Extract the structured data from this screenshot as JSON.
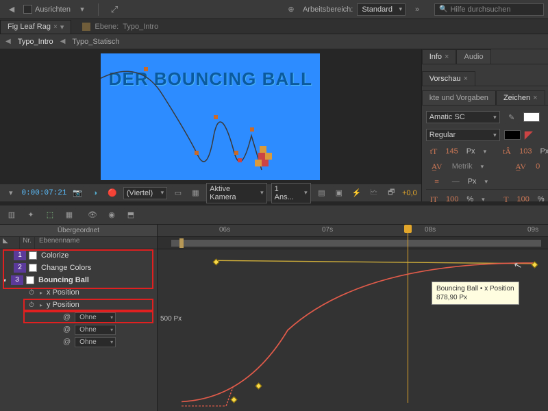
{
  "top": {
    "align": "Ausrichten",
    "workspace_label": "Arbeitsbereich:",
    "workspace_value": "Standard",
    "search_placeholder": "Hilfe durchsuchen"
  },
  "project": {
    "tab": "Fig Leaf Rag",
    "layer_label": "Ebene:",
    "layer_name": "Typo_Intro"
  },
  "crumb": {
    "a": "Typo_Intro",
    "b": "Typo_Statisch"
  },
  "canvas": {
    "title": "DER BOUNCING BALL"
  },
  "side": {
    "info_tab": "Info",
    "audio_tab": "Audio",
    "preview_tab": "Vorschau",
    "presets_tab": "kte und Vorgaben",
    "char_tab": "Zeichen",
    "font": "Amatic SC",
    "weight": "Regular",
    "size": "145",
    "size_unit": "Px",
    "leading": "103",
    "leading_unit": "Px",
    "kern": "Metrik",
    "track": "0",
    "vscale": "—",
    "vscale_unit": "Px",
    "scale1": "100",
    "scale2": "100",
    "scale_unit": "%"
  },
  "viewer": {
    "timecode": "0:00:07:21",
    "resolution": "(Viertel)",
    "camera": "Aktive Kamera",
    "views": "1 Ans...",
    "plus": "+0,0"
  },
  "timeline": {
    "parent": "Übergeordnet",
    "col_nr": "Nr.",
    "col_name": "Ebenenname",
    "layers": [
      {
        "nr": "1",
        "name": "Colorize"
      },
      {
        "nr": "2",
        "name": "Change Colors"
      },
      {
        "nr": "3",
        "name": "Bouncing Ball"
      }
    ],
    "prop_x": "x Position",
    "prop_y": "y Position",
    "ohne": "Ohne",
    "ruler": {
      "t6": "06s",
      "t7": "07s",
      "t8": "08s",
      "t9": "09s"
    },
    "ylabel": "500 Px",
    "tooltip_l1": "Bouncing Ball • x Position",
    "tooltip_l2": "878,90 Px"
  }
}
